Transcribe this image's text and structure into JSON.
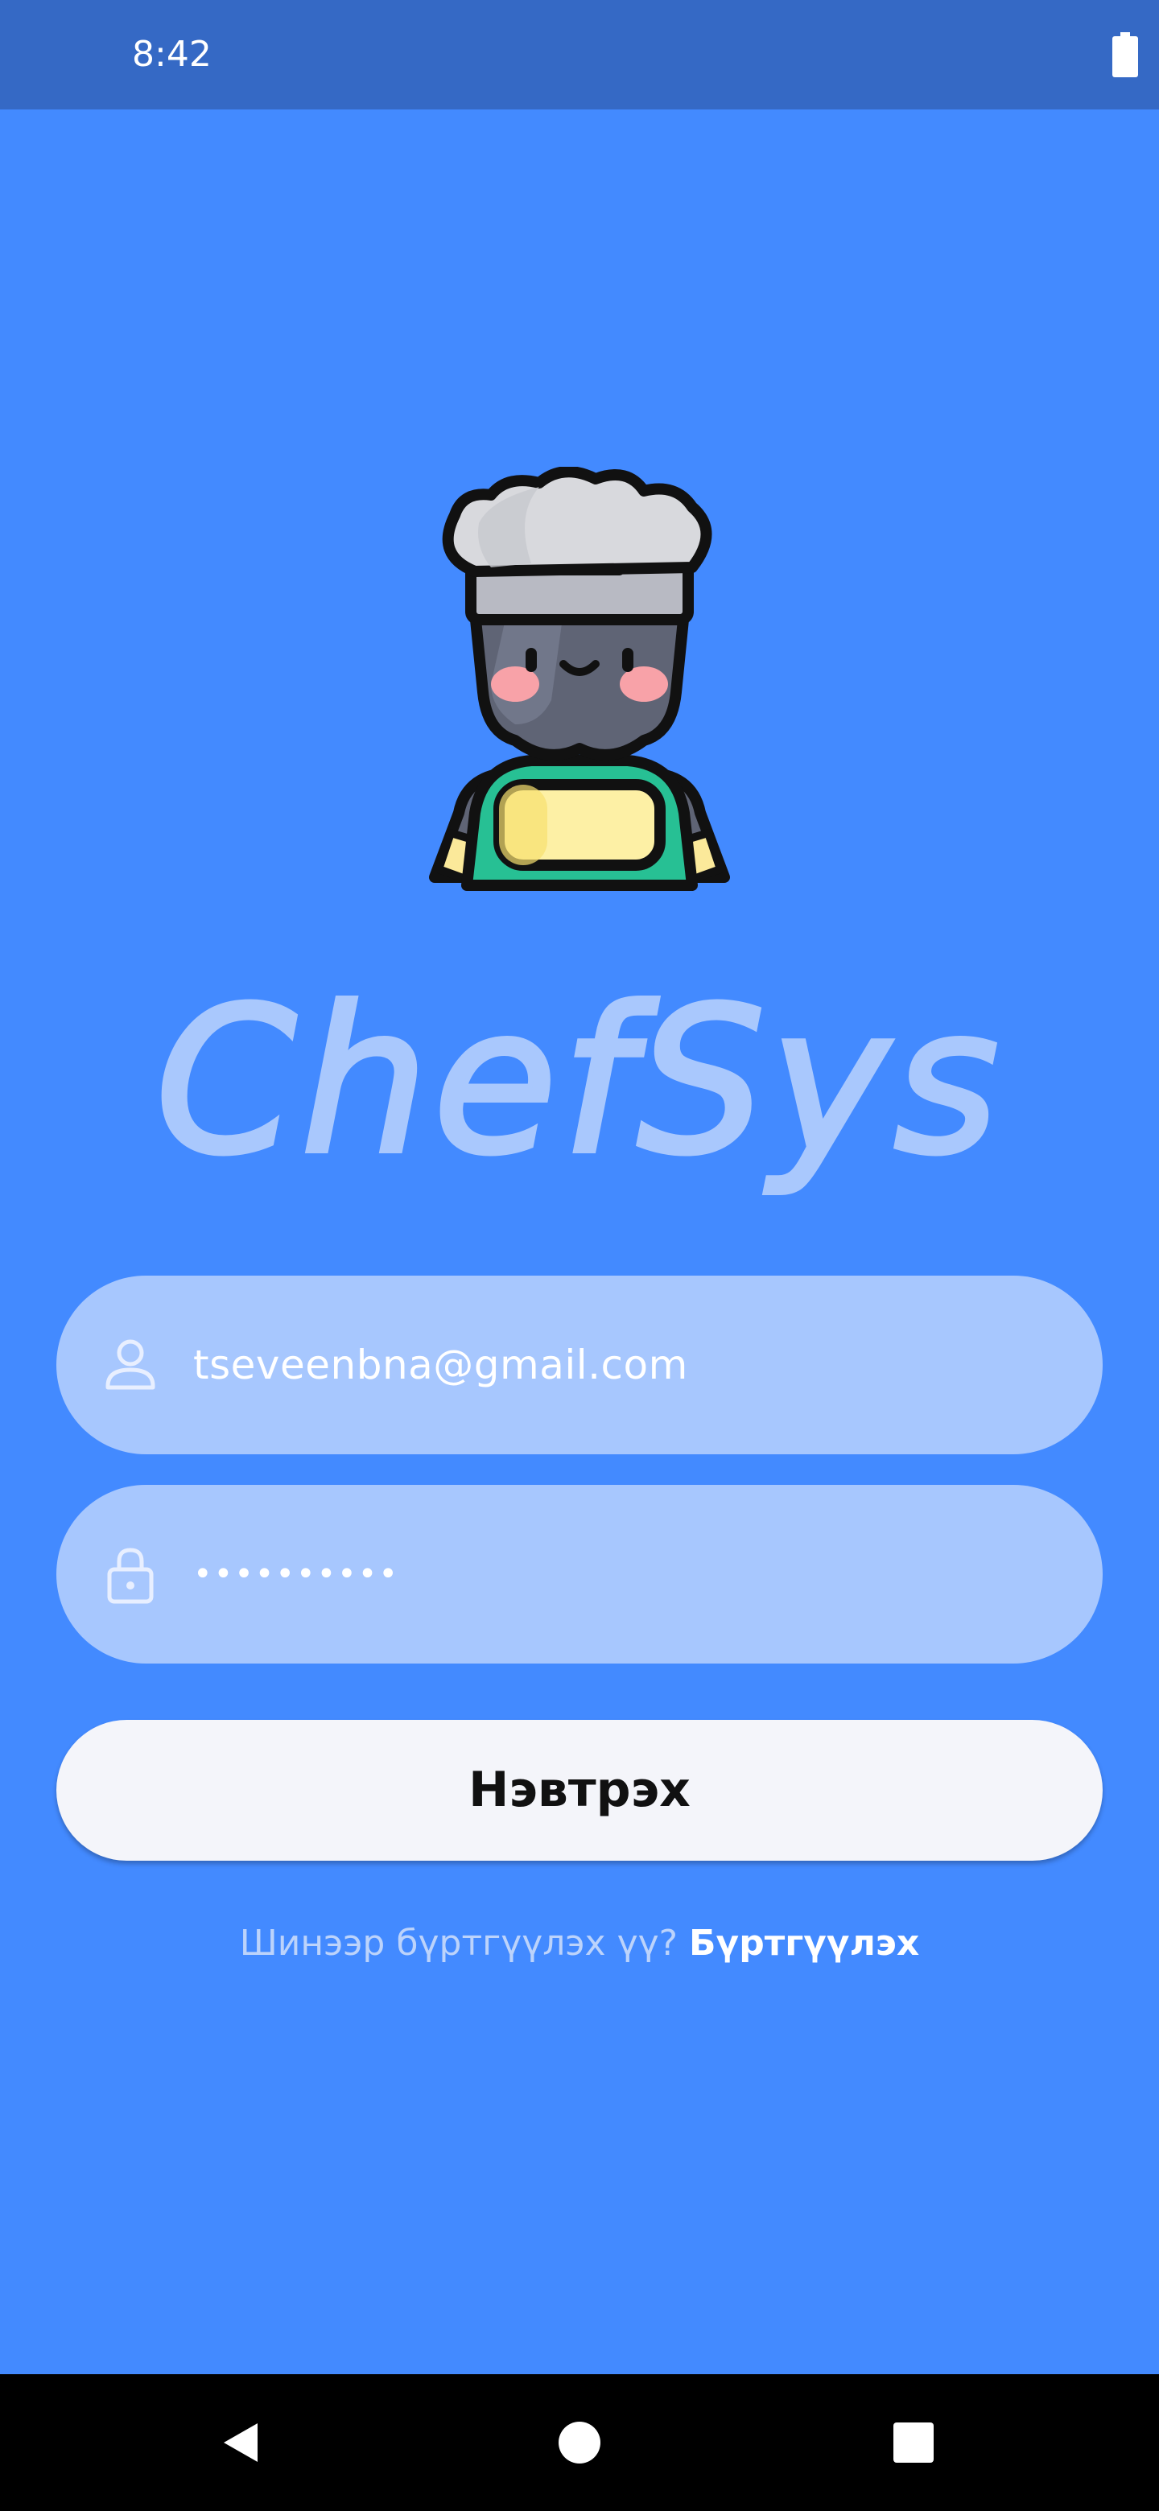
{
  "status_bar": {
    "time": "8:42"
  },
  "brand": {
    "name": "ChefSys"
  },
  "login_form": {
    "email": {
      "value": "tseveenbna@gmail.com",
      "icon": "user-icon"
    },
    "password": {
      "masked_value": "••••••••••",
      "icon": "lock-icon"
    },
    "login_button_label": "Нэвтрэх"
  },
  "signup": {
    "prompt": "Шинээр бүртгүүлэх үү?",
    "link_label": "Бүртгүүлэх"
  },
  "colors": {
    "background": "#438aff",
    "status_bar": "#3569c5",
    "field_fill": "#a7c7fe",
    "button_fill": "#f4f5fa"
  },
  "nav_bar": {
    "buttons": [
      "back-icon",
      "home-icon",
      "recents-icon"
    ]
  }
}
